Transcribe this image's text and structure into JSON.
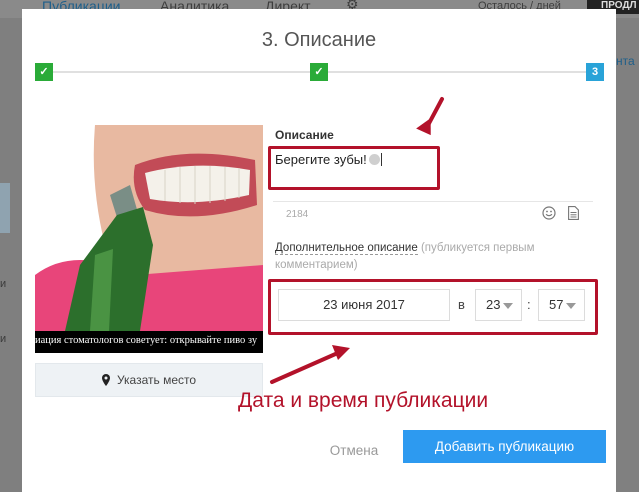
{
  "background_nav": {
    "tabs": [
      "Публикации",
      "Аналитика",
      "Директ"
    ],
    "remaining_label": "Осталось / дней",
    "extra_label": "ПРОДЛ",
    "left_fragments": [
      "и",
      "и"
    ],
    "right_fragment": "нта"
  },
  "modal": {
    "title": "3. Описание",
    "steps": [
      "✓",
      "✓",
      "3"
    ],
    "image_caption": "иация стоматологов советует: открывайте пиво зу",
    "place_button": "Указать место",
    "description_label": "Описание",
    "description_value": "Берегите зубы!",
    "char_count": "2184",
    "extra_description_link": "Дополнительное описание",
    "extra_description_hint": "(публикуется первым комментарием)",
    "date_value": "23 июня 2017",
    "in_label": "в",
    "hour_value": "23",
    "minute_value": "57",
    "time_separator": ":",
    "cancel_button": "Отмена",
    "add_button": "Добавить публикацию"
  },
  "annotation": {
    "label": "Дата и время публикации",
    "color": "#b3122a"
  },
  "colors": {
    "step_done": "#2aab38",
    "step_current": "#29a3d8",
    "primary": "#2d9af0"
  }
}
